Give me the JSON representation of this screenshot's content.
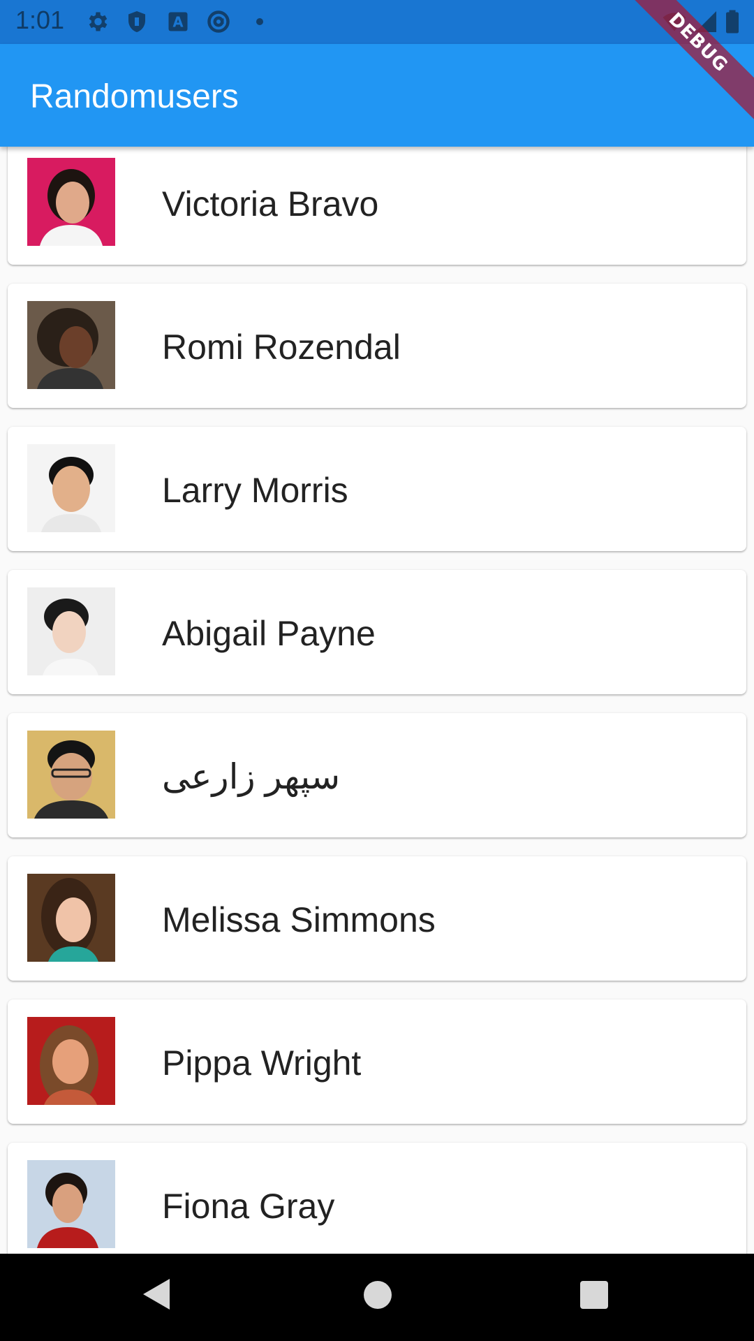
{
  "status_bar": {
    "time": "1:01",
    "icons": [
      "settings-icon",
      "shield-icon",
      "text-a-icon",
      "at-sign-icon",
      "dot-icon",
      "wifi-icon",
      "signal-icon",
      "battery-icon"
    ]
  },
  "app_bar": {
    "title": "Randomusers",
    "background": "#2196f3"
  },
  "debug_banner": "DEBUG",
  "users": [
    {
      "name": "Victoria Bravo",
      "avatar_bg": "#d81b60",
      "skin": "#e0a98a",
      "hair": "#1d1410",
      "shirt": "#f5f5f5"
    },
    {
      "name": "Romi Rozendal",
      "avatar_bg": "#6b5a4a",
      "skin": "#6b3f2a",
      "hair": "#2a2018",
      "shirt": "#333333"
    },
    {
      "name": "Larry Morris",
      "avatar_bg": "#f4f4f4",
      "skin": "#e2b08a",
      "hair": "#111111",
      "shirt": "#e8e8e8"
    },
    {
      "name": "Abigail Payne",
      "avatar_bg": "#eeeeee",
      "skin": "#f1d3c0",
      "hair": "#1a1a1a",
      "shirt": "#f7f7f7"
    },
    {
      "name": "سپهر زارعی",
      "avatar_bg": "#d9b86a",
      "skin": "#d6a37e",
      "hair": "#141414",
      "shirt": "#2b2b2b"
    },
    {
      "name": "Melissa Simmons",
      "avatar_bg": "#5a3a22",
      "skin": "#f0c3a8",
      "hair": "#3a2416",
      "shirt": "#26a69a"
    },
    {
      "name": "Pippa Wright",
      "avatar_bg": "#b71c1c",
      "skin": "#e6a07a",
      "hair": "#7a4a2a",
      "shirt": "#c45a3a"
    },
    {
      "name": "Fiona Gray",
      "avatar_bg": "#c7d6e6",
      "skin": "#d9a07e",
      "hair": "#1c1410",
      "shirt": "#b71c1c"
    }
  ],
  "nav_bar": {
    "back": "back-icon",
    "home": "home-icon",
    "recents": "recents-icon"
  }
}
